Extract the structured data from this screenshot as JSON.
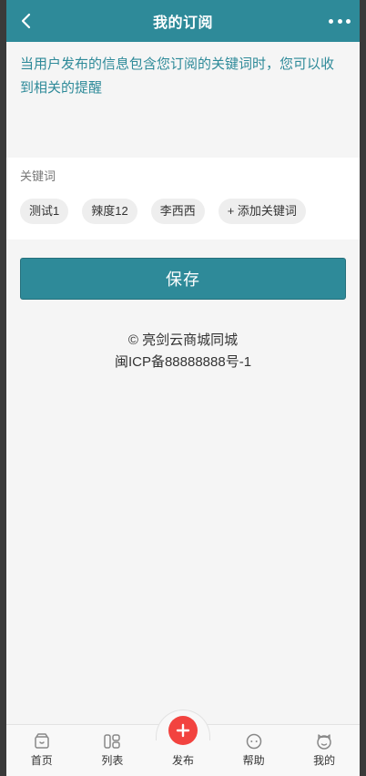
{
  "header": {
    "title": "我的订阅"
  },
  "notice": "当用户发布的信息包含您订阅的关键词时，您可以收到相关的提醒",
  "keywords": {
    "label": "关键词",
    "tags": [
      "测试1",
      "辣度12",
      "李西西"
    ],
    "add_label": "+ 添加关键词"
  },
  "save_label": "保存",
  "footer": {
    "copyright": "© 亮剑云商城同城",
    "icp": "闽ICP备88888888号-1"
  },
  "tabbar": {
    "items": [
      {
        "label": "首页",
        "icon": "home-icon"
      },
      {
        "label": "列表",
        "icon": "list-icon"
      },
      {
        "label": "发布",
        "icon": "plus-icon"
      },
      {
        "label": "帮助",
        "icon": "chat-icon"
      },
      {
        "label": "我的",
        "icon": "user-icon"
      }
    ]
  },
  "colors": {
    "primary": "#2e8a99",
    "accent": "#f2433f",
    "background": "#f5f5f5"
  }
}
